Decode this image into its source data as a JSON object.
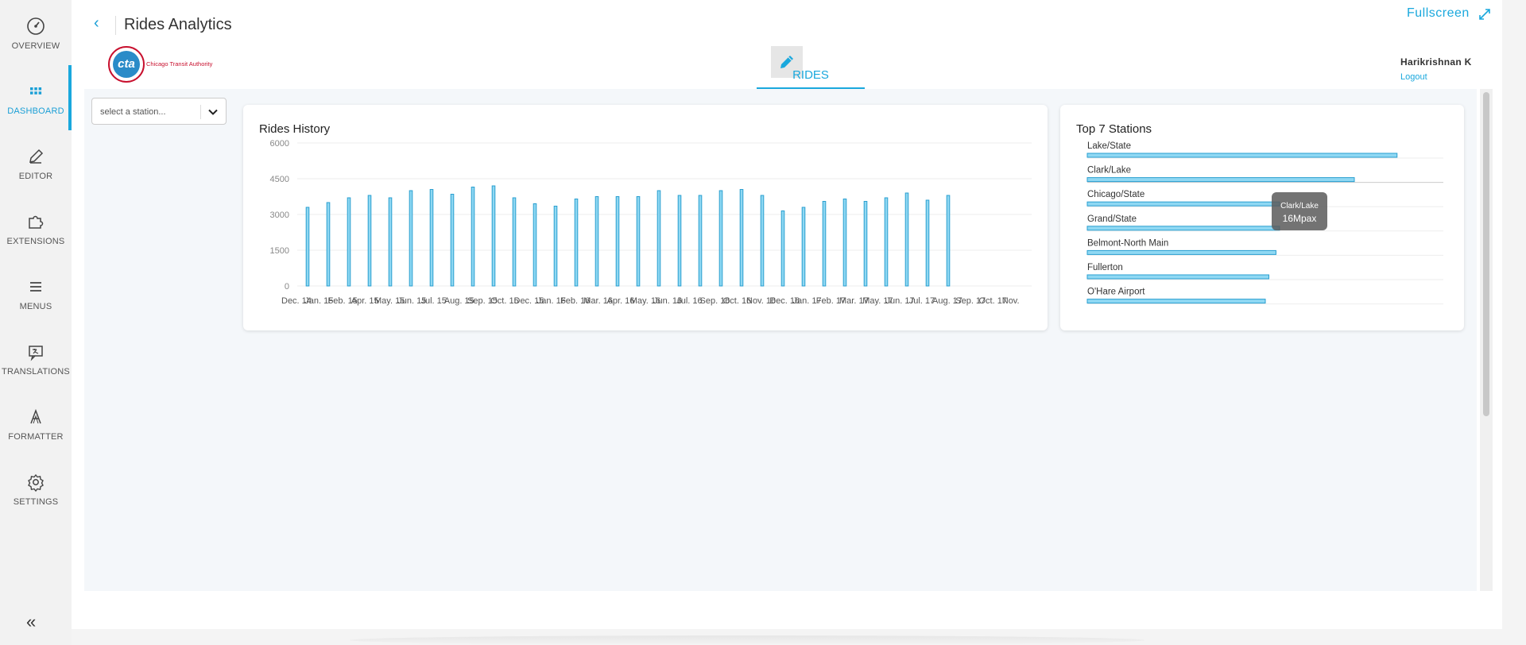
{
  "sidebar": {
    "items": [
      {
        "label": "OVERVIEW",
        "icon": "speedometer-icon"
      },
      {
        "label": "DASHBOARD",
        "icon": "grid-icon",
        "active": true
      },
      {
        "label": "EDITOR",
        "icon": "pencil-icon"
      },
      {
        "label": "EXTENSIONS",
        "icon": "puzzle-icon"
      },
      {
        "label": "MENUS",
        "icon": "menu-icon"
      },
      {
        "label": "TRANSLATIONS",
        "icon": "translate-icon"
      },
      {
        "label": "FORMATTER",
        "icon": "formatter-icon"
      },
      {
        "label": "SETTINGS",
        "icon": "gear-icon"
      }
    ],
    "collapse_label": "«"
  },
  "header": {
    "back": "‹",
    "title": "Rides Analytics",
    "fullscreen_label": "Fullscreen"
  },
  "logo": {
    "mark": "cta",
    "text": "Chicago Transit Authority"
  },
  "tab": {
    "label": "RIDES"
  },
  "user": {
    "name": "Harikrishnan K",
    "logout_label": "Logout"
  },
  "filter": {
    "placeholder": "select a station..."
  },
  "colors": {
    "accent": "#1aa8dd",
    "bar_fill": "#8fd8f3",
    "bar_stroke": "#2a9fd0"
  },
  "chart_data": [
    {
      "type": "bar",
      "title": "Rides History",
      "ylim": [
        0,
        6000
      ],
      "y_ticks": [
        0,
        1500,
        3000,
        4500,
        6000
      ],
      "categories": [
        "Dec. 14",
        "Jan. 15",
        "Feb. 15",
        "Apr. 15",
        "May. 15",
        "Jun. 15",
        "Jul. 15",
        "Aug. 15",
        "Sep. 15",
        "Oct. 15",
        "Dec. 15",
        "Jan. 16",
        "Feb. 16",
        "Mar. 16",
        "Apr. 16",
        "May. 16",
        "Jun. 16",
        "Jul. 16",
        "Sep. 16",
        "Oct. 16",
        "Nov. 16",
        "Dec. 16",
        "Jan. 17",
        "Feb. 17",
        "Mar. 17",
        "May. 17",
        "Jun. 17",
        "Jul. 17",
        "Aug. 17",
        "Sep. 17",
        "Oct. 17",
        "Nov."
      ],
      "values": [
        3300,
        3500,
        3700,
        3800,
        3700,
        4000,
        4050,
        3850,
        4150,
        4200,
        3700,
        3450,
        3350,
        3650,
        3750,
        3750,
        3750,
        4000,
        3800,
        3800,
        4000,
        4050,
        3800,
        3150,
        3300,
        3550,
        3650,
        3550,
        3700,
        3900,
        3600,
        3800,
        null,
        null,
        null,
        null
      ],
      "tick_labels": [
        "Dec. 14",
        "Jan. 15",
        "Feb. 15",
        "Apr. 15",
        "May. 15",
        "Jun. 15",
        "Jul. 15",
        "Aug. 15",
        "Sep. 15",
        "Oct. 15",
        "Dec. 15",
        "Jan. 16",
        "Feb. 16",
        "Mar. 16",
        "Apr. 16",
        "May. 16",
        "Jun. 16",
        "Jul. 16",
        "Sep. 16",
        "Oct. 16",
        "Nov. 16",
        "Dec. 16",
        "Jan. 17",
        "Feb. 17",
        "Mar. 17",
        "May. 17",
        "Jun. 17",
        "Jul. 17",
        "Aug. 17",
        "Sep. 17",
        "Oct. 17",
        "Nov."
      ],
      "grid": true
    },
    {
      "type": "bar",
      "orientation": "horizontal",
      "title": "Top 7 Stations",
      "categories": [
        "Lake/State",
        "Clark/Lake",
        "Chicago/State",
        "Grand/State",
        "Belmont-North Main",
        "Fullerton",
        "O'Hare Airport"
      ],
      "values": [
        87,
        75,
        54,
        54,
        53,
        51,
        50
      ],
      "tooltip": {
        "station": "Clark/Lake",
        "value": "16Mpax"
      }
    }
  ]
}
